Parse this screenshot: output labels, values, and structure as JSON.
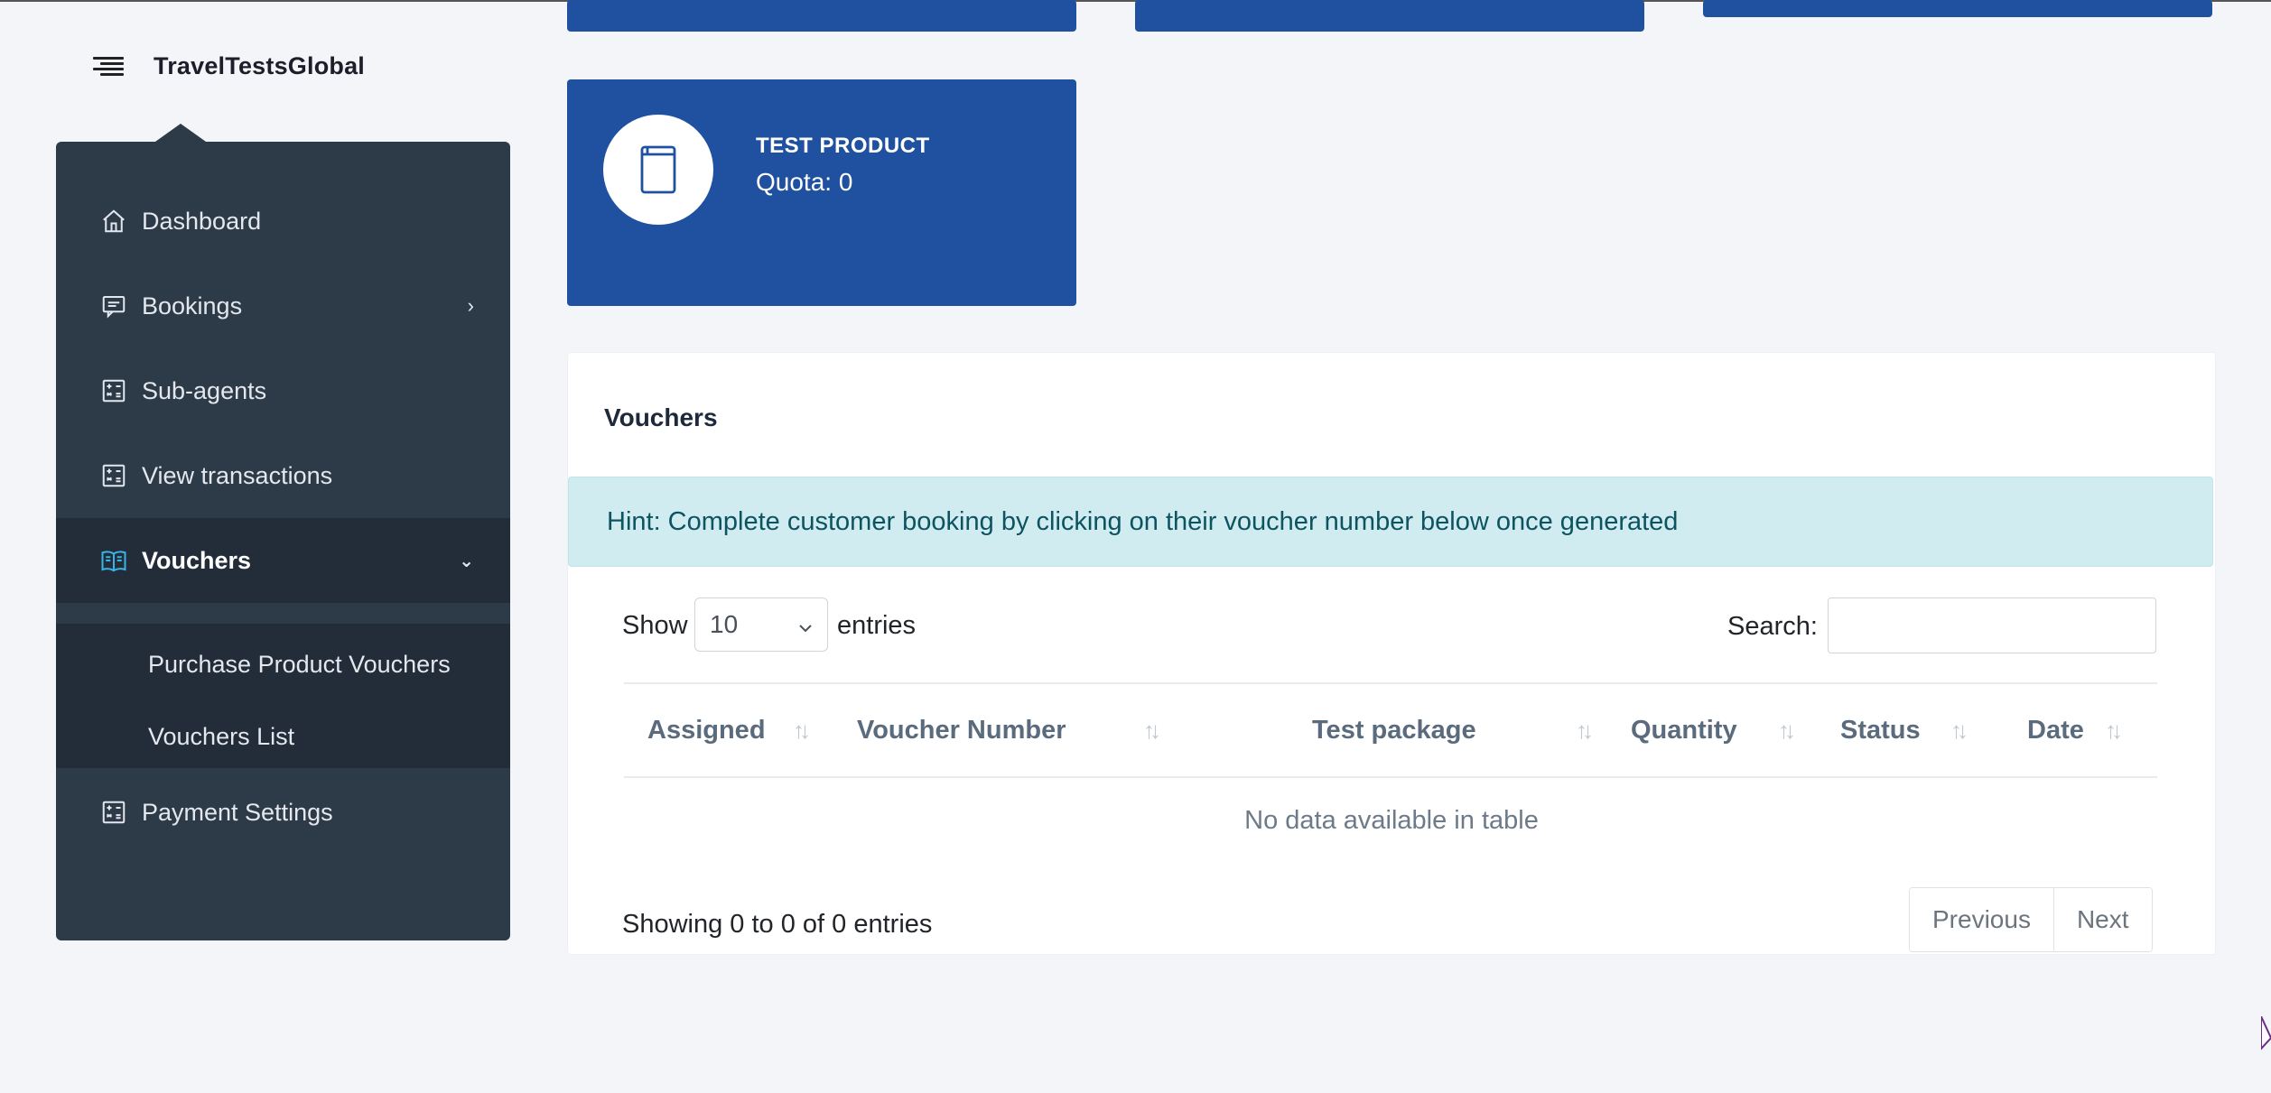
{
  "brand": {
    "name": "TravelTestsGlobal"
  },
  "sidebar": {
    "items": [
      {
        "label": "Dashboard",
        "icon": "home-icon"
      },
      {
        "label": "Bookings",
        "icon": "message-icon",
        "has_children": true
      },
      {
        "label": "Sub-agents",
        "icon": "calculator-icon"
      },
      {
        "label": "View transactions",
        "icon": "calculator-icon"
      },
      {
        "label": "Vouchers",
        "icon": "book-icon",
        "expanded": true,
        "active": true
      },
      {
        "label": "Payment Settings",
        "icon": "calculator-icon"
      }
    ],
    "vouchers_submenu": [
      "Purchase Product Vouchers",
      "Vouchers List"
    ]
  },
  "product_card": {
    "title": "TEST PRODUCT",
    "quota": "Quota: 0",
    "icon": "book-icon"
  },
  "vouchers": {
    "title": "Vouchers",
    "hint": "Hint: Complete customer booking by clicking on their voucher number below once generated",
    "length": {
      "show_label": "Show",
      "selected": "10",
      "entries_label": "entries"
    },
    "search_label": "Search:",
    "columns": [
      "Assigned",
      "Voucher Number",
      "Test package",
      "Quantity",
      "Status",
      "Date"
    ],
    "empty_message": "No data available in table",
    "info": "Showing 0 to 0 of 0 entries",
    "pagination": {
      "previous": "Previous",
      "next": "Next"
    }
  },
  "colors": {
    "sidebar": "#2d3a48",
    "sidebar_active": "#222d39",
    "card_blue": "#1f51a0",
    "hint_bg": "#d1ecf1",
    "hint_text": "#0c5460",
    "accent_icon": "#3ab4e6"
  }
}
